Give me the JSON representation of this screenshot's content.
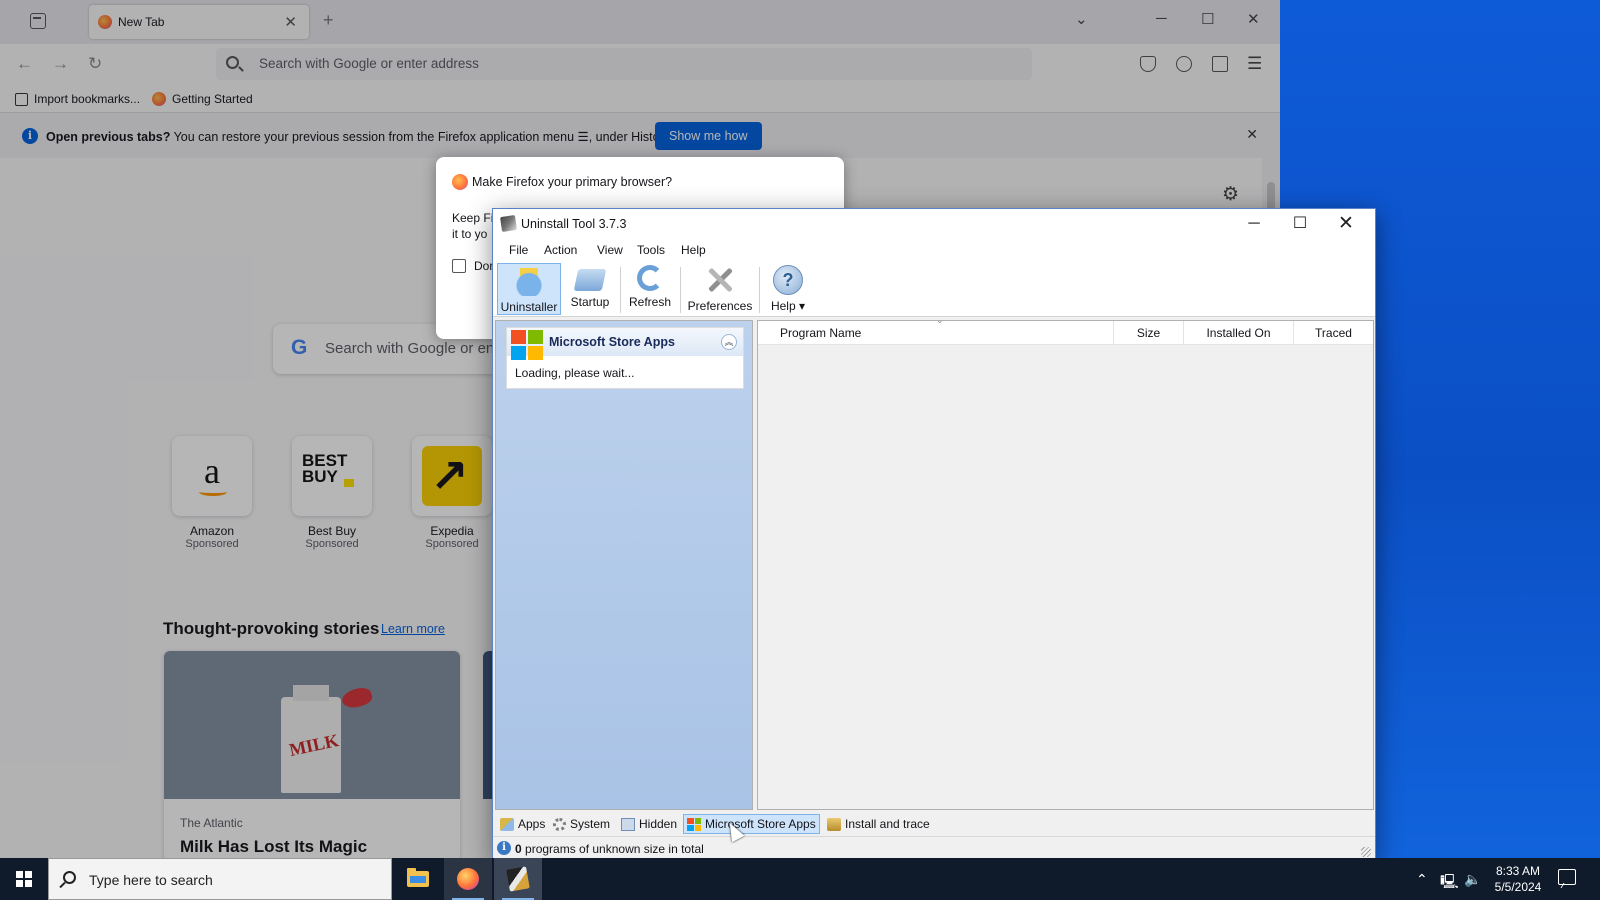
{
  "firefox": {
    "tab_title": "New Tab",
    "url_placeholder": "Search with Google or enter address",
    "bookmarks": [
      "Import bookmarks...",
      "Getting Started"
    ],
    "infobar": {
      "bold": "Open previous tabs?",
      "message": " You can restore your previous session from the Firefox application menu ☰, under History.",
      "button": "Show me how"
    },
    "search_placeholder": "Search with Google or en",
    "top_sites": [
      {
        "name": "Amazon",
        "label": "Sponsored"
      },
      {
        "name": "Best Buy",
        "label": "Sponsored"
      },
      {
        "name": "Expedia",
        "label": "Sponsored"
      }
    ],
    "stories": {
      "heading": "Thought-provoking stories",
      "learn_more": "Learn more",
      "card_publisher": "The Atlantic",
      "card_title": "Milk Has Lost Its Magic",
      "card_image_text": "MILK"
    },
    "dialog": {
      "title": "Make Firefox your primary browser?",
      "body_line1": "Keep Fi",
      "body_line2": "it to yo",
      "checkbox_label": "Dor"
    },
    "bestbuy_logo": "BEST BUY"
  },
  "uninstall_tool": {
    "title": "Uninstall Tool 3.7.3",
    "menu": [
      "File",
      "Action",
      "View",
      "Tools",
      "Help"
    ],
    "toolbar": {
      "uninstaller": "Uninstaller",
      "startup": "Startup",
      "refresh": "Refresh",
      "preferences": "Preferences",
      "help": "Help ▾"
    },
    "sidebar": {
      "group_title": "Microsoft Store Apps",
      "loading": "Loading, please wait..."
    },
    "columns": [
      "Program Name",
      "Size",
      "Installed On",
      "Traced"
    ],
    "tabs": [
      "Apps",
      "System",
      "Hidden",
      "Microsoft Store Apps",
      "Install and trace"
    ],
    "status": {
      "count": "0",
      "text": " programs of unknown size in total"
    },
    "ms_colors": [
      "#f25022",
      "#7fba00",
      "#00a4ef",
      "#ffb900"
    ]
  },
  "taskbar": {
    "search_placeholder": "Type here to search",
    "time": "8:33 AM",
    "date": "5/5/2024"
  }
}
